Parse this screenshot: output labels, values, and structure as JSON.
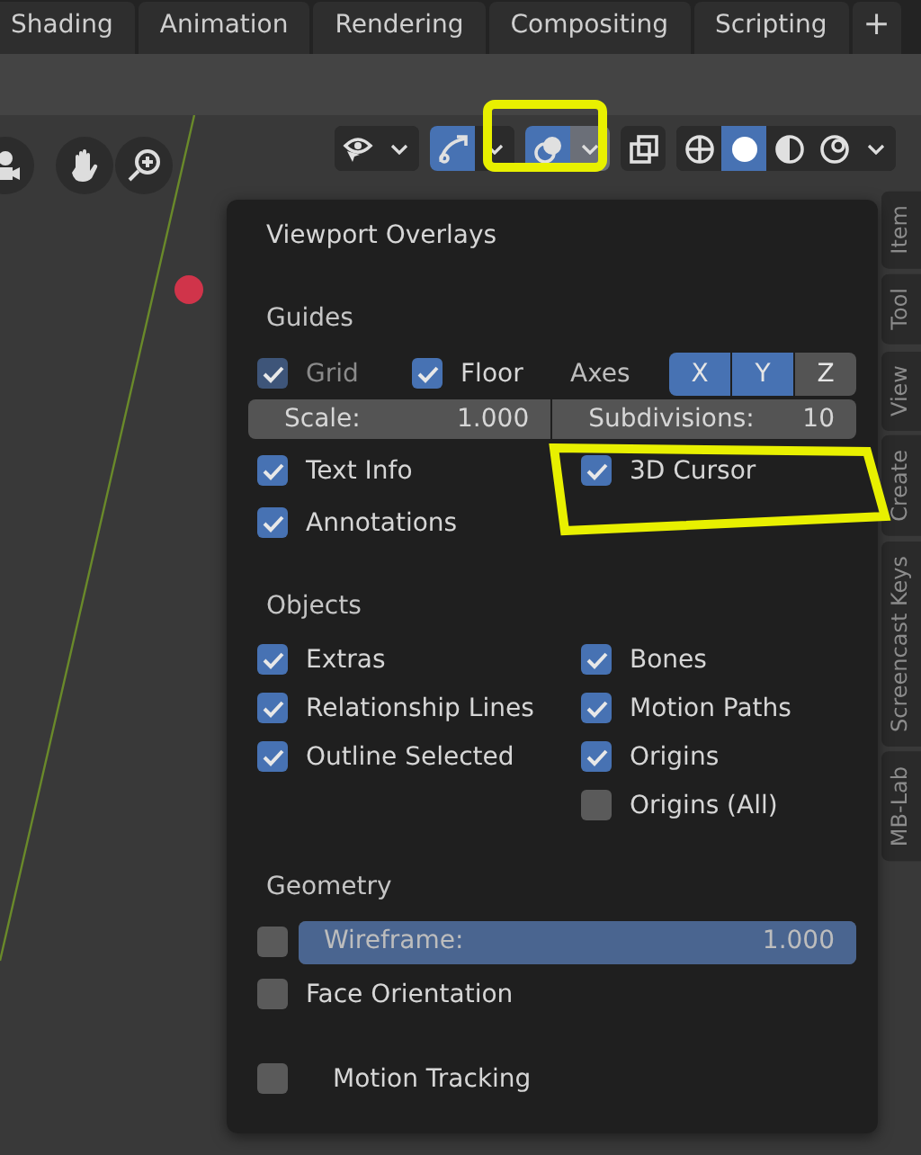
{
  "workspace_tabs": [
    {
      "label": "Shading"
    },
    {
      "label": "Animation"
    },
    {
      "label": "Rendering"
    },
    {
      "label": "Compositing"
    },
    {
      "label": "Scripting"
    }
  ],
  "add_tab": "+",
  "header_toolbar": [
    {
      "kind": "visibility",
      "selected": false
    },
    {
      "kind": "gizmo",
      "selected": true
    },
    {
      "kind": "overlays",
      "selected": true
    },
    {
      "kind": "xray",
      "selected": false
    },
    {
      "kind": "wireframe",
      "selected": false
    },
    {
      "kind": "solid",
      "selected": true
    },
    {
      "kind": "material",
      "selected": false
    },
    {
      "kind": "rendered",
      "selected": false
    }
  ],
  "sidebar_tabs": [
    {
      "label": "Item"
    },
    {
      "label": "Tool"
    },
    {
      "label": "View"
    },
    {
      "label": "Create"
    },
    {
      "label": "Screencast Keys"
    },
    {
      "label": "MB-Lab"
    }
  ],
  "popover": {
    "title": "Viewport Overlays",
    "guides": {
      "heading": "Guides",
      "grid": {
        "label": "Grid",
        "checked": true,
        "disabled": true
      },
      "floor": {
        "label": "Floor",
        "checked": true,
        "disabled": false
      },
      "axes_label": "Axes",
      "axes": [
        {
          "label": "X",
          "selected": true
        },
        {
          "label": "Y",
          "selected": true
        },
        {
          "label": "Z",
          "selected": false
        }
      ],
      "scale": {
        "label": "Scale:",
        "value": "1.000"
      },
      "subdivisions": {
        "label": "Subdivisions:",
        "value": "10"
      },
      "toggles": [
        {
          "label": "Text Info",
          "checked": true
        },
        {
          "label": "3D Cursor",
          "checked": true
        },
        {
          "label": "Annotations",
          "checked": true
        }
      ]
    },
    "objects": {
      "heading": "Objects",
      "toggles": [
        {
          "label": "Extras",
          "checked": true
        },
        {
          "label": "Bones",
          "checked": true
        },
        {
          "label": "Relationship Lines",
          "checked": true
        },
        {
          "label": "Motion Paths",
          "checked": true
        },
        {
          "label": "Outline Selected",
          "checked": true
        },
        {
          "label": "Origins",
          "checked": true
        },
        {
          "label": "Origins (All)",
          "checked": false
        }
      ]
    },
    "geometry": {
      "heading": "Geometry",
      "wireframe": {
        "checked": false,
        "label": "Wireframe:",
        "value": "1.000",
        "level": 1
      },
      "face_orientation": {
        "label": "Face Orientation",
        "checked": false
      }
    },
    "motion_tracking": {
      "label": "Motion Tracking",
      "checked": false
    }
  }
}
